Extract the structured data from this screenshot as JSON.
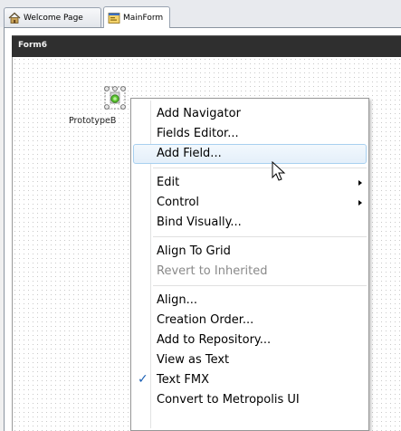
{
  "tabs": [
    {
      "label": "Welcome Page",
      "icon": "home-page-icon",
      "active": false
    },
    {
      "label": "MainForm",
      "icon": "form-designer-icon",
      "active": true
    }
  ],
  "form": {
    "title": "Form6"
  },
  "component": {
    "label": "PrototypeB",
    "icon": "prototype-bind-source-icon"
  },
  "context_menu": {
    "items": [
      {
        "label": "Add Navigator"
      },
      {
        "label": "Fields Editor..."
      },
      {
        "label": "Add Field...",
        "state": "hover"
      },
      {
        "label": "Edit",
        "submenu": true
      },
      {
        "label": "Control",
        "submenu": true
      },
      {
        "label": "Bind Visually..."
      },
      {
        "label": "Align To Grid"
      },
      {
        "label": "Revert to Inherited",
        "state": "disabled"
      },
      {
        "label": "Align..."
      },
      {
        "label": "Creation Order..."
      },
      {
        "label": "Add to Repository..."
      },
      {
        "label": "View as Text"
      },
      {
        "label": "Text FMX",
        "checked": true
      },
      {
        "label": "Convert to Metropolis UI"
      }
    ]
  },
  "colors": {
    "form_titlebar": "#2f2f2f",
    "menu_hover_border": "#a8d0f0",
    "check_mark": "#1a5fb4"
  }
}
